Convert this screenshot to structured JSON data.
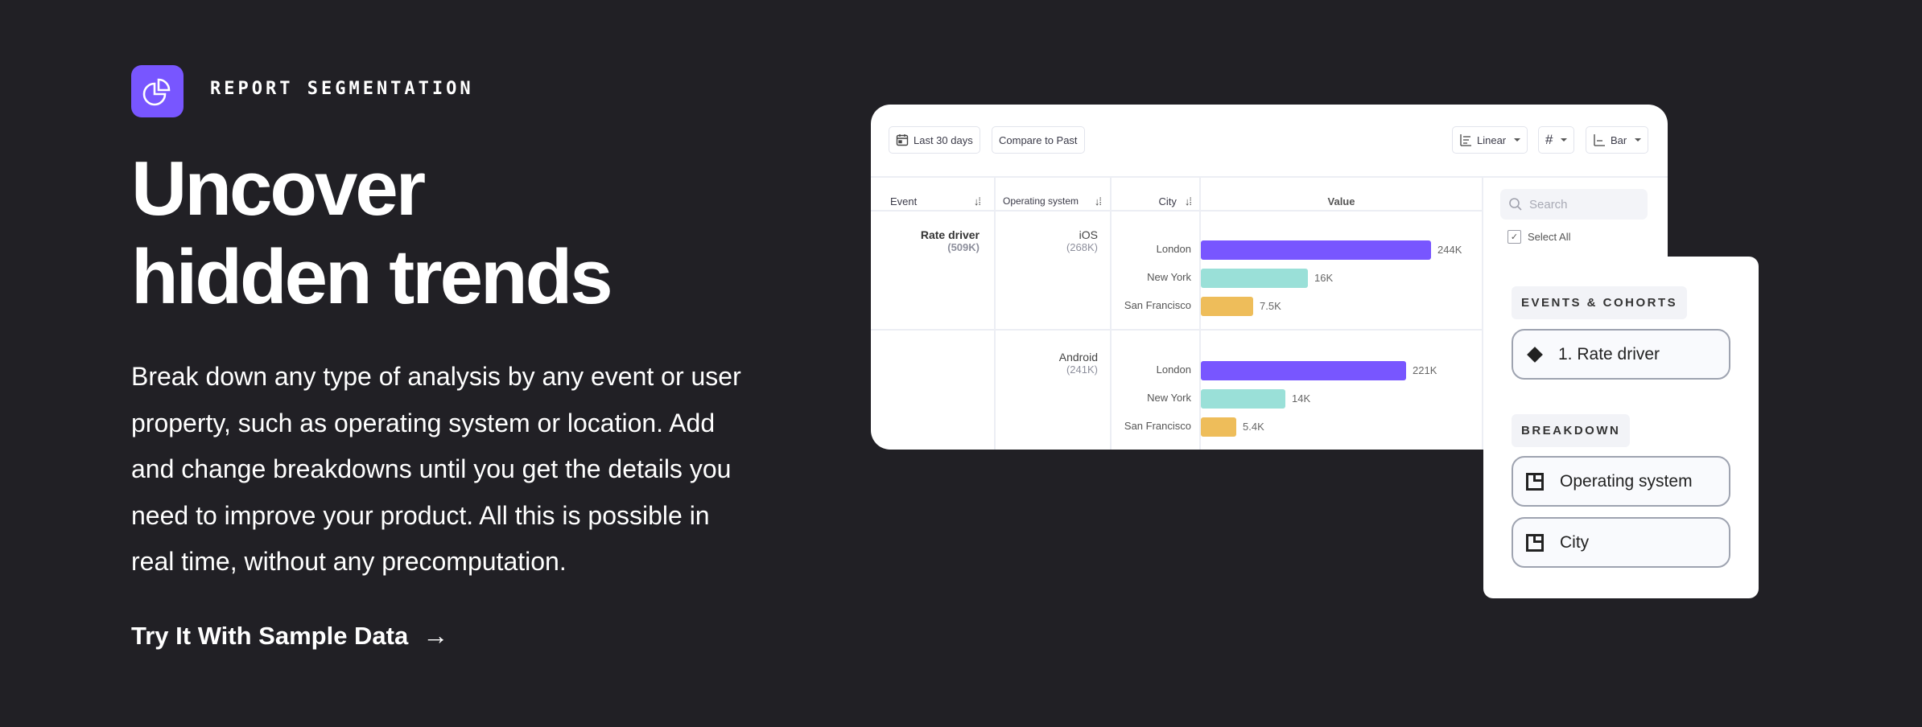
{
  "hero": {
    "eyebrow": "REPORT SEGMENTATION",
    "headline_line1": "Uncover",
    "headline_line2": "hidden trends",
    "body": "Break down any type of analysis by any event or user property, such as operating system or location. Add and change breakdowns until you get the details you need to improve your product. All this is possible in real time, without any precomputation.",
    "cta_label": "Try It With Sample Data",
    "cta_arrow": "→",
    "accent_color": "#7856ff"
  },
  "report": {
    "toolbar": {
      "date_range": "Last 30 days",
      "compare": "Compare to Past",
      "scale": "Linear",
      "number_format_icon": "#",
      "chart_type": "Bar"
    },
    "columns": [
      "Event",
      "Operating system",
      "City",
      "Value"
    ],
    "event": {
      "name": "Rate driver",
      "total": "(509K)"
    },
    "groups": [
      {
        "os": "iOS",
        "total": "(268K)",
        "rows": [
          {
            "city": "London",
            "label": "244K",
            "fill": 0.84,
            "color": "#7856ff"
          },
          {
            "city": "New York",
            "label": "16K",
            "fill": 0.39,
            "color": "#9ae0d8"
          },
          {
            "city": "San Francisco",
            "label": "7.5K",
            "fill": 0.19,
            "color": "#eebd5a"
          }
        ]
      },
      {
        "os": "Android",
        "total": "(241K)",
        "rows": [
          {
            "city": "London",
            "label": "221K",
            "fill": 0.75,
            "color": "#7856ff"
          },
          {
            "city": "New York",
            "label": "14K",
            "fill": 0.31,
            "color": "#9ae0d8"
          },
          {
            "city": "San Francisco",
            "label": "5.4K",
            "fill": 0.13,
            "color": "#eebd5a"
          }
        ]
      }
    ],
    "sidebar": {
      "search_placeholder": "Search",
      "select_all": "Select All"
    }
  },
  "panel": {
    "events_label": "EVENTS & COHORTS",
    "event_chip": "1. Rate driver",
    "breakdown_label": "BREAKDOWN",
    "breakdowns": [
      "Operating system",
      "City"
    ]
  }
}
